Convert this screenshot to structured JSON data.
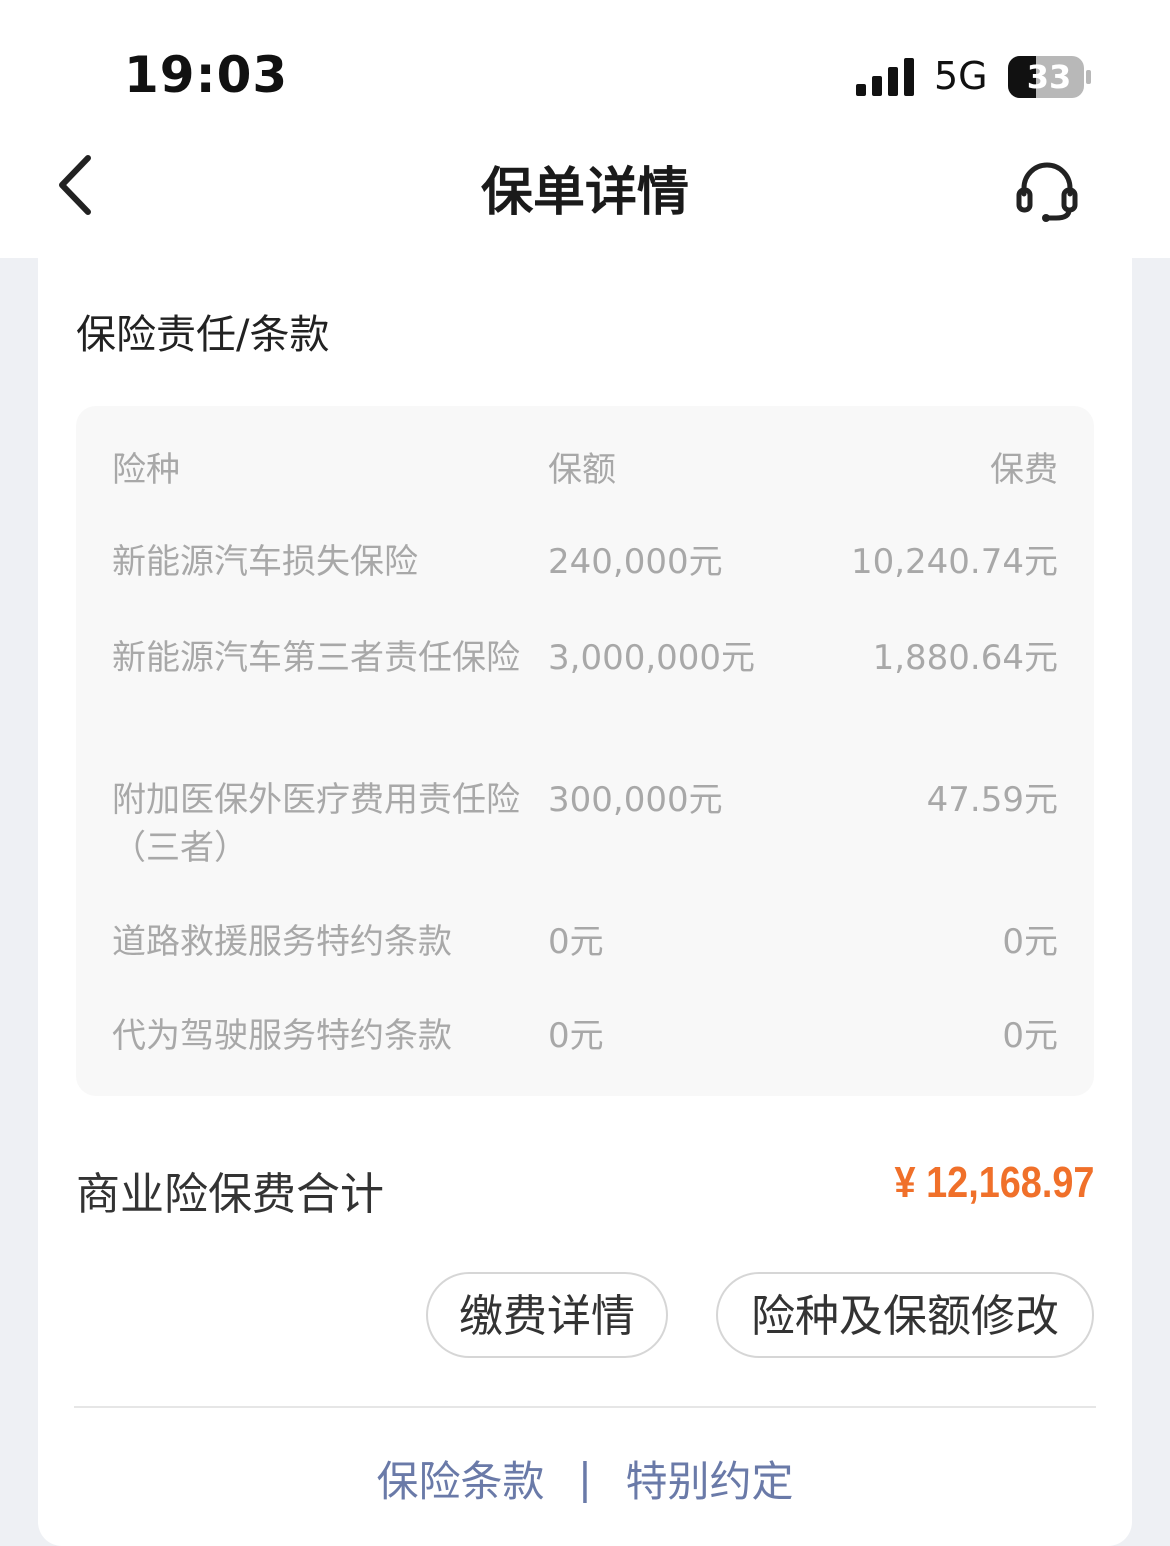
{
  "status_bar": {
    "time": "19:03",
    "network": "5G",
    "battery": "33",
    "signal_icon": "signal-bars-icon"
  },
  "nav": {
    "title": "保单详情",
    "back_icon": "chevron-left-icon",
    "support_icon": "headset-icon"
  },
  "section": {
    "title": "保险责任/条款"
  },
  "table": {
    "headers": {
      "name": "险种",
      "amount": "保额",
      "premium": "保费"
    },
    "rows": [
      {
        "name": "新能源汽车损失保险",
        "amount": "240,000元",
        "premium": "10,240.74元"
      },
      {
        "name": "新能源汽车第三者责任保险",
        "amount": "3,000,000元",
        "premium": "1,880.64元"
      },
      {
        "name": "附加医保外医疗费用责任险（三者）",
        "amount": "300,000元",
        "premium": "47.59元"
      },
      {
        "name": "道路救援服务特约条款",
        "amount": "0元",
        "premium": "0元"
      },
      {
        "name": "代为驾驶服务特约条款",
        "amount": "0元",
        "premium": "0元"
      }
    ]
  },
  "total": {
    "label": "商业险保费合计",
    "value": "¥ 12,168.97"
  },
  "actions": {
    "payment_details": "缴费详情",
    "modify_coverage": "险种及保额修改"
  },
  "footer": {
    "terms": "保险条款",
    "separator": "|",
    "special": "特别约定"
  },
  "colors": {
    "accent": "#f0702a",
    "link": "#6a7aa8"
  }
}
